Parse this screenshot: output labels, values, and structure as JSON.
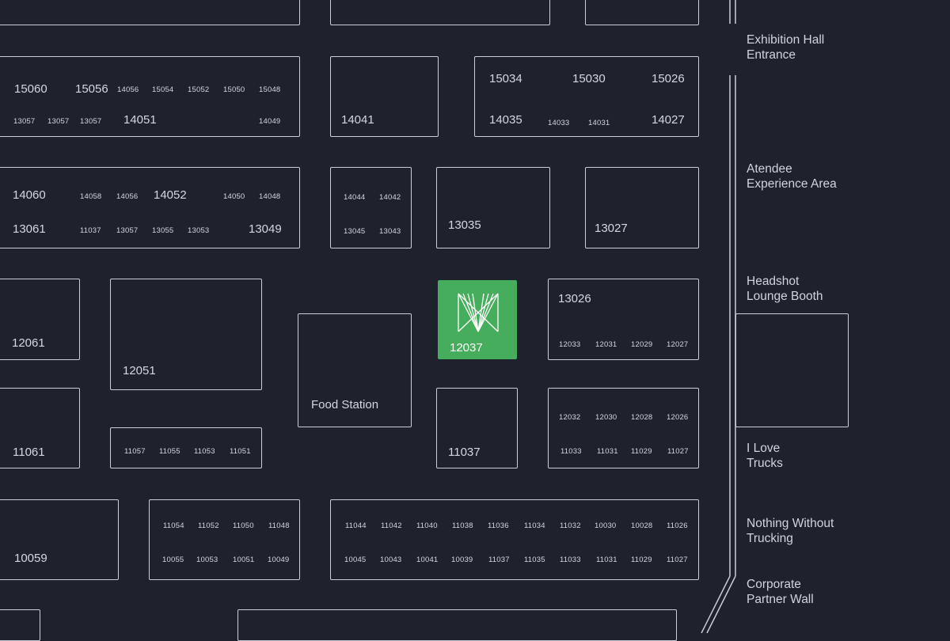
{
  "colors": {
    "background": "#1d222c",
    "booth_outline": "#c9ced8",
    "highlight": "#46ad5c"
  },
  "booths": {
    "b15060": "15060",
    "b15056": "15056",
    "b14056a": "14056",
    "b15054": "15054",
    "b15052": "15052",
    "b15050": "15050",
    "b15048": "15048",
    "b13057a": "13057",
    "b13057b": "13057",
    "b13057c": "13057",
    "b14051": "14051",
    "b14049": "14049",
    "b14041": "14041",
    "b15034": "15034",
    "b15030": "15030",
    "b15026": "15026",
    "b14035": "14035",
    "b14033": "14033",
    "b14031": "14031",
    "b14027": "14027",
    "b14060": "14060",
    "b14058": "14058",
    "b14056b": "14056",
    "b14052": "14052",
    "b14050": "14050",
    "b14048": "14048",
    "b13061": "13061",
    "b11037a": "11037",
    "b13057d": "13057",
    "b13055": "13055",
    "b13053": "13053",
    "b13049": "13049",
    "b14044": "14044",
    "b14042": "14042",
    "b13045": "13045",
    "b13043": "13043",
    "b13035": "13035",
    "b13027": "13027",
    "b12061": "12061",
    "b12051": "12051",
    "food": "Food Station",
    "b12037": "12037",
    "b13026": "13026",
    "b12033": "12033",
    "b12031": "12031",
    "b12029": "12029",
    "b12027": "12027",
    "b11061": "11061",
    "b11057": "11057",
    "b11055": "11055",
    "b11053": "11053",
    "b11051": "11051",
    "b11037b": "11037",
    "b12032": "12032",
    "b12030": "12030",
    "b12028": "12028",
    "b12026": "12026",
    "b11033a": "11033",
    "b11031a": "11031",
    "b11029a": "11029",
    "b11027a": "11027",
    "b10059": "10059",
    "b11054": "11054",
    "b11052": "11052",
    "b11050": "11050",
    "b11048": "11048",
    "b10055": "10055",
    "b10053": "10053",
    "b10051": "10051",
    "b10049": "10049",
    "b11044": "11044",
    "b11042": "11042",
    "b11040": "11040",
    "b11038": "11038",
    "b11036": "11036",
    "b11034": "11034",
    "b11032": "11032",
    "b10030": "10030",
    "b10028": "10028",
    "b11026": "11026",
    "b10045": "10045",
    "b10043": "10043",
    "b10041": "10041",
    "b10039": "10039",
    "b11037c": "11037",
    "b11035": "11035",
    "b11033b": "11033",
    "b11031b": "11031",
    "b11029b": "11029",
    "b11027b": "11027"
  },
  "side_labels": {
    "entrance": "Exhibition Hall\nEntrance",
    "experience": "Atendee\nExperience Area",
    "headshot": "Headshot\nLounge Booth",
    "trucks": "I Love\nTrucks",
    "nothing": "Nothing Without\nTrucking",
    "corporate": "Corporate\nPartner Wall"
  },
  "highlighted_booth_icon": "sponsor-logo-icon"
}
